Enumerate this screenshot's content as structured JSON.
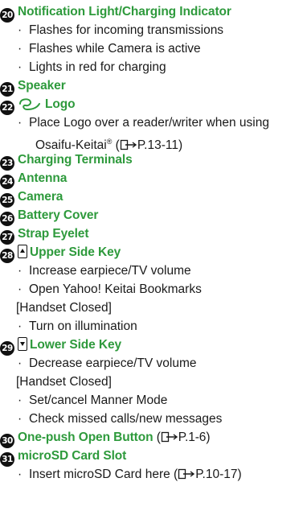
{
  "items": {
    "n20": {
      "num": "20",
      "title": "Notification Light/Charging Indicator"
    },
    "b20_1": "Flashes for incoming transmissions",
    "b20_2": "Flashes while Camera is active",
    "b20_3": "Lights in red for charging",
    "n21": {
      "num": "21",
      "title": "Speaker"
    },
    "n22": {
      "num": "22",
      "title": "Logo",
      "icon": "felica-logo-icon"
    },
    "b22_1": "Place Logo over a reader/writer when using",
    "b22_2a": "Osaifu-Keitai",
    "b22_2reg": "®",
    "b22_2b": " (",
    "b22_2ref": "P.13-11",
    "b22_2c": ")",
    "n23": {
      "num": "23",
      "title": "Charging Terminals"
    },
    "n24": {
      "num": "24",
      "title": "Antenna"
    },
    "n25": {
      "num": "25",
      "title": "Camera"
    },
    "n26": {
      "num": "26",
      "title": "Battery Cover"
    },
    "n27": {
      "num": "27",
      "title": "Strap Eyelet"
    },
    "n28": {
      "num": "28",
      "title": "Upper Side Key",
      "icon": "up-side-key-icon"
    },
    "b28_1": "Increase earpiece/TV volume",
    "b28_2": "Open Yahoo! Keitai Bookmarks",
    "s28": "[Handset Closed]",
    "b28_3": "Turn on illumination",
    "n29": {
      "num": "29",
      "title": "Lower Side Key",
      "icon": "down-side-key-icon"
    },
    "b29_1": "Decrease earpiece/TV volume",
    "s29": "[Handset Closed]",
    "b29_2": "Set/cancel Manner Mode",
    "b29_3": "Check missed calls/new messages",
    "n30": {
      "num": "30",
      "title": "One-push Open Button",
      "ref_open": " (",
      "ref": "P.1-6",
      "ref_close": ")"
    },
    "n31": {
      "num": "31",
      "title": "microSD Card Slot"
    },
    "b31_1a": "Insert microSD Card here (",
    "b31_1ref": "P.10-17",
    "b31_1c": ")"
  },
  "bullet_glyph": "·",
  "colors": {
    "heading": "#2e9a3c",
    "text": "#1a1a1a",
    "number_badge": "#111111"
  }
}
